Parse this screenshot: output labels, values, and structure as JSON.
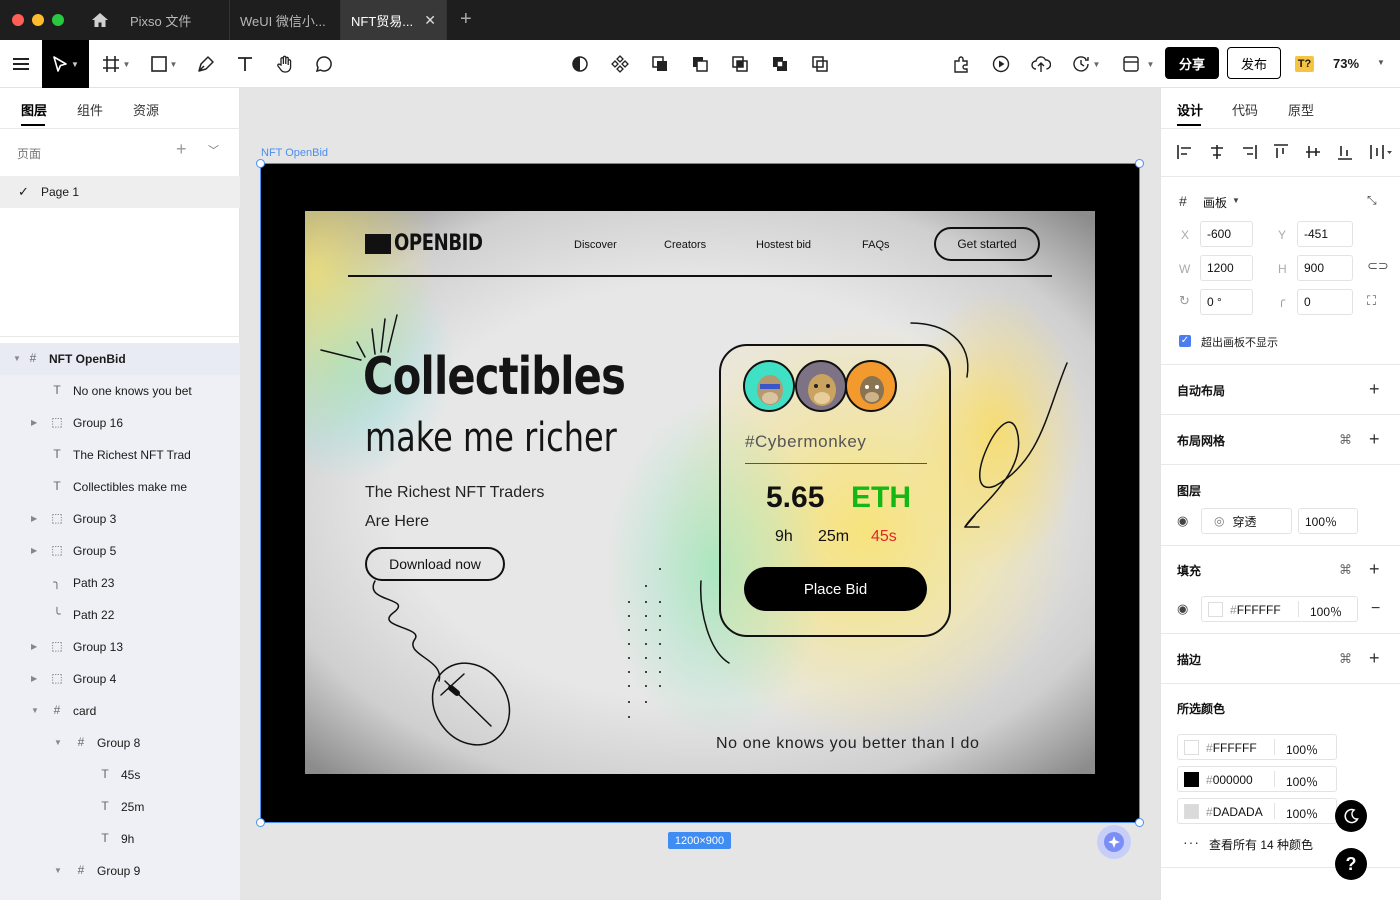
{
  "tabs": [
    {
      "label": "Pixso 文件"
    },
    {
      "label": "WeUI 微信小..."
    },
    {
      "label": "NFT贸易..."
    }
  ],
  "toolbar": {
    "share_label": "分享",
    "publish_label": "发布",
    "font_warning": "T?",
    "zoom": "73%"
  },
  "left_panel": {
    "tabs": [
      "图层",
      "组件",
      "资源"
    ],
    "pages_label": "页面",
    "pages": [
      {
        "name": "Page 1"
      }
    ],
    "layers": [
      {
        "name": "NFT OpenBid"
      },
      {
        "name": "No one knows you bet"
      },
      {
        "name": "Group 16"
      },
      {
        "name": "The Richest NFT Trad"
      },
      {
        "name": "Collectibles make me"
      },
      {
        "name": "Group 3"
      },
      {
        "name": "Group 5"
      },
      {
        "name": "Path 23"
      },
      {
        "name": "Path 22"
      },
      {
        "name": "Group 13"
      },
      {
        "name": "Group 4"
      },
      {
        "name": "card"
      },
      {
        "name": "Group 8"
      },
      {
        "name": "45s"
      },
      {
        "name": "25m"
      },
      {
        "name": "9h"
      },
      {
        "name": "Group 9"
      }
    ]
  },
  "canvas": {
    "frame_label": "NFT OpenBid",
    "size_badge": "1200×900"
  },
  "poster": {
    "logo": "OPENBID",
    "nav": [
      "Discover",
      "Creators",
      "Hostest bid",
      "FAQs"
    ],
    "cta": "Get started",
    "title": "Collectibles",
    "subtitle": "make me richer",
    "tagline_line1": "The Richest NFT Traders",
    "tagline_line2": "Are Here",
    "download": "Download now",
    "quote": "No one knows you better than I do",
    "card": {
      "handle": "#Cybermonkey",
      "price": "5.65",
      "currency": "ETH",
      "hours": "9h",
      "minutes": "25m",
      "seconds": "45s",
      "bid_label": "Place Bid"
    },
    "colors": {
      "eth": "#14b814",
      "seconds": "#e02828"
    }
  },
  "right_panel": {
    "tabs": [
      "设计",
      "代码",
      "原型"
    ],
    "frame_type": "画板",
    "x": "-600",
    "y": "-451",
    "w": "1200",
    "h": "900",
    "rotation": "0 °",
    "radius": "0",
    "clip_label": "超出画板不显示",
    "auto_layout": "自动布局",
    "layout_grid": "布局网格",
    "layer_section": "图层",
    "blend_mode": "穿透",
    "opacity": "100％",
    "fill_section": "填充",
    "fill_hex": "FFFFFF",
    "fill_pct": "100％",
    "stroke_section": "描边",
    "selected_colors_section": "所选颜色",
    "selected_colors": [
      {
        "hex": "FFFFFF",
        "pct": "100％",
        "color": "#FFFFFF"
      },
      {
        "hex": "000000",
        "pct": "100％",
        "color": "#000000"
      },
      {
        "hex": "DADADA",
        "pct": "100％",
        "color": "#DADADA"
      }
    ],
    "view_all_colors": "查看所有 14 种颜色",
    "x_label": "X",
    "y_label": "Y",
    "w_label": "W",
    "h_label": "H",
    "hash": "#"
  }
}
